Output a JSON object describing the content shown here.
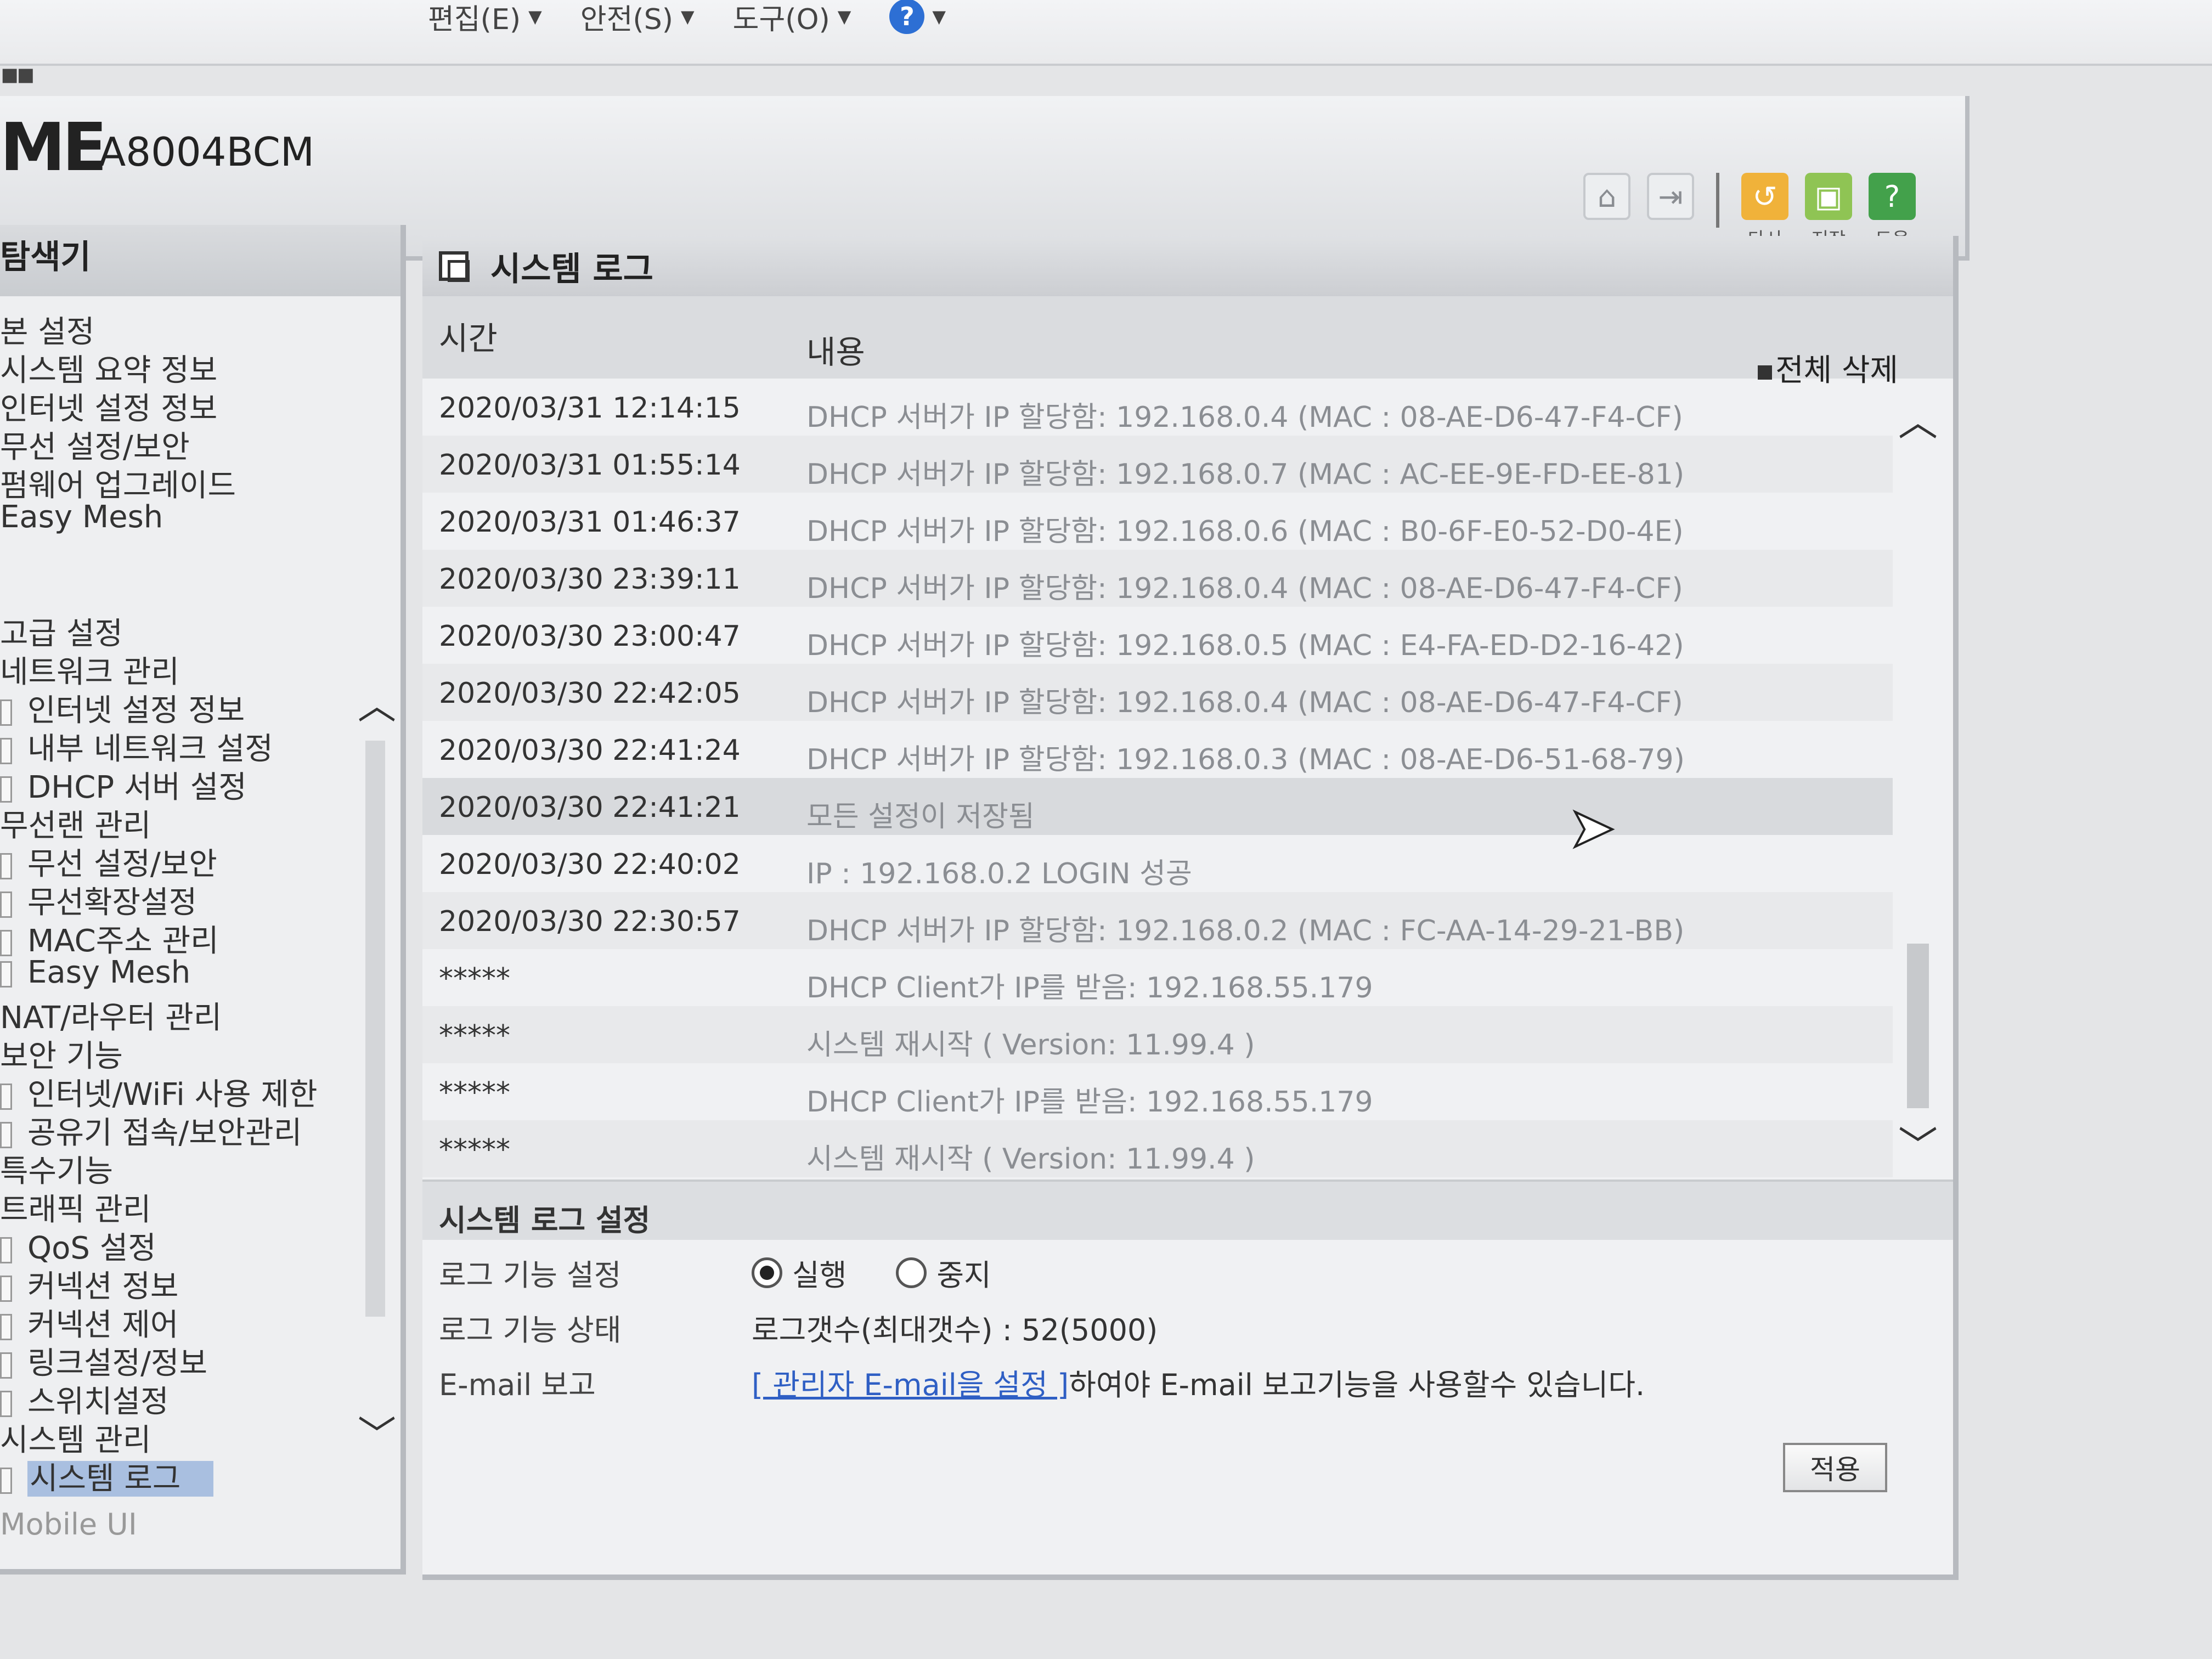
{
  "browser": {
    "menu": [
      {
        "label": "편집(E)"
      },
      {
        "label": "안전(S)"
      },
      {
        "label": "도구(O)"
      }
    ],
    "help_icon": "help-icon"
  },
  "header": {
    "brand": "ME",
    "model": "A8004BCM",
    "toolbar": [
      {
        "icon": "home-icon",
        "label": ""
      },
      {
        "icon": "logout-icon",
        "label": ""
      },
      {
        "icon": "refresh-icon",
        "label": "다시"
      },
      {
        "icon": "save-icon",
        "label": "저장"
      },
      {
        "icon": "help-icon",
        "label": "도움"
      }
    ]
  },
  "sidebar": {
    "title": "탐색기",
    "items": [
      {
        "label": "본 설정",
        "box": false
      },
      {
        "label": "시스템 요약 정보",
        "box": false
      },
      {
        "label": "인터넷 설정 정보",
        "box": false
      },
      {
        "label": "무선 설정/보안",
        "box": false
      },
      {
        "label": "펌웨어 업그레이드",
        "box": false
      },
      {
        "label": "Easy Mesh",
        "box": false
      },
      {
        "label": "고급 설정",
        "box": false
      },
      {
        "label": "네트워크 관리",
        "box": false
      },
      {
        "label": "인터넷 설정 정보",
        "box": true
      },
      {
        "label": "내부 네트워크 설정",
        "box": true
      },
      {
        "label": "DHCP 서버 설정",
        "box": true
      },
      {
        "label": "무선랜 관리",
        "box": false
      },
      {
        "label": "무선 설정/보안",
        "box": true
      },
      {
        "label": "무선확장설정",
        "box": true
      },
      {
        "label": "MAC주소 관리",
        "box": true
      },
      {
        "label": "Easy Mesh",
        "box": true
      },
      {
        "label": "NAT/라우터 관리",
        "box": false
      },
      {
        "label": "보안 기능",
        "box": false
      },
      {
        "label": "인터넷/WiFi 사용 제한",
        "box": true
      },
      {
        "label": "공유기 접속/보안관리",
        "box": true
      },
      {
        "label": "특수기능",
        "box": false
      },
      {
        "label": "트래픽 관리",
        "box": false
      },
      {
        "label": "QoS 설정",
        "box": true
      },
      {
        "label": "커넥션 정보",
        "box": true
      },
      {
        "label": "커넥션 제어",
        "box": true
      },
      {
        "label": "링크설정/정보",
        "box": true
      },
      {
        "label": "스위치설정",
        "box": true
      },
      {
        "label": "시스템 관리",
        "box": false
      },
      {
        "label": "시스템 로그",
        "box": true,
        "active": true
      }
    ],
    "footer": "Mobile UI"
  },
  "main": {
    "title": "시스템 로그",
    "col_time": "시간",
    "col_content": "내용",
    "delete_all": "전체 삭제",
    "logs": [
      {
        "time": "2020/03/31 12:14:15",
        "text": "DHCP 서버가 IP 할당함: 192.168.0.4 (MAC : 08-AE-D6-47-F4-CF)"
      },
      {
        "time": "2020/03/31 01:55:14",
        "text": "DHCP 서버가 IP 할당함: 192.168.0.7 (MAC : AC-EE-9E-FD-EE-81)"
      },
      {
        "time": "2020/03/31 01:46:37",
        "text": "DHCP 서버가 IP 할당함: 192.168.0.6 (MAC : B0-6F-E0-52-D0-4E)"
      },
      {
        "time": "2020/03/30 23:39:11",
        "text": "DHCP 서버가 IP 할당함: 192.168.0.4 (MAC : 08-AE-D6-47-F4-CF)"
      },
      {
        "time": "2020/03/30 23:00:47",
        "text": "DHCP 서버가 IP 할당함: 192.168.0.5 (MAC : E4-FA-ED-D2-16-42)"
      },
      {
        "time": "2020/03/30 22:42:05",
        "text": "DHCP 서버가 IP 할당함: 192.168.0.4 (MAC : 08-AE-D6-47-F4-CF)"
      },
      {
        "time": "2020/03/30 22:41:24",
        "text": "DHCP 서버가 IP 할당함: 192.168.0.3 (MAC : 08-AE-D6-51-68-79)"
      },
      {
        "time": "2020/03/30 22:41:21",
        "text": "모든 설정이 저장됨"
      },
      {
        "time": "2020/03/30 22:40:02",
        "text": "IP : 192.168.0.2 LOGIN 성공"
      },
      {
        "time": "2020/03/30 22:30:57",
        "text": "DHCP 서버가 IP 할당함: 192.168.0.2 (MAC : FC-AA-14-29-21-BB)"
      },
      {
        "time": "*****",
        "text": "DHCP Client가 IP를 받음: 192.168.55.179"
      },
      {
        "time": "*****",
        "text": "시스템 재시작 ( Version: 11.99.4 )"
      },
      {
        "time": "*****",
        "text": "DHCP Client가 IP를 받음: 192.168.55.179"
      },
      {
        "time": "*****",
        "text": "시스템 재시작 ( Version: 11.99.4 )"
      }
    ],
    "settings": {
      "title": "시스템 로그 설정",
      "log_func_label": "로그 기능 설정",
      "radio_run": "실행",
      "radio_stop": "중지",
      "radio_selected": "실행",
      "log_status_label": "로그 기능 상태",
      "log_status_value": "로그갯수(최대갯수) : 52(5000)",
      "email_label": "E-mail 보고",
      "email_link": "[ 관리자 E-mail을 설정 ]",
      "email_text": "하여야 E-mail 보고기능을 사용할수 있습니다.",
      "apply": "적용"
    }
  }
}
